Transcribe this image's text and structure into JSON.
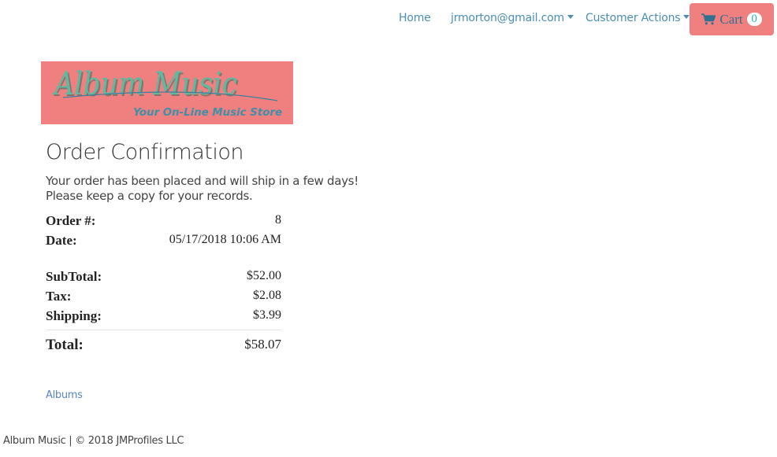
{
  "nav": {
    "home": "Home",
    "user": "jrmorton@gmail.com",
    "customer_actions": "Customer Actions",
    "cart_label": "Cart",
    "cart_count": "0"
  },
  "logo": {
    "title": "Album Music",
    "tagline": "Your On-Line Music Store",
    "background_color": "#f08080",
    "text_color": "#5fb8a0"
  },
  "page": {
    "title": "Order Confirmation",
    "message_line1": "Your order has been placed and will ship in a few days!",
    "message_line2": "Please keep a copy for your records."
  },
  "order": {
    "number_label": "Order #:",
    "number": "8",
    "date_label": "Date:",
    "date": "05/17/2018 10:06 AM",
    "subtotal_label": "SubTotal:",
    "subtotal": "$52.00",
    "tax_label": "Tax:",
    "tax": "$2.08",
    "shipping_label": "Shipping:",
    "shipping": "$3.99",
    "total_label": "Total:",
    "total": "$58.07"
  },
  "links": {
    "albums": "Albums"
  },
  "footer": {
    "text": "Album Music | © 2018 JMProfiles LLC"
  },
  "colors": {
    "accent": "#f08080",
    "link": "#4a8fb5",
    "cart_text": "#31708f"
  }
}
